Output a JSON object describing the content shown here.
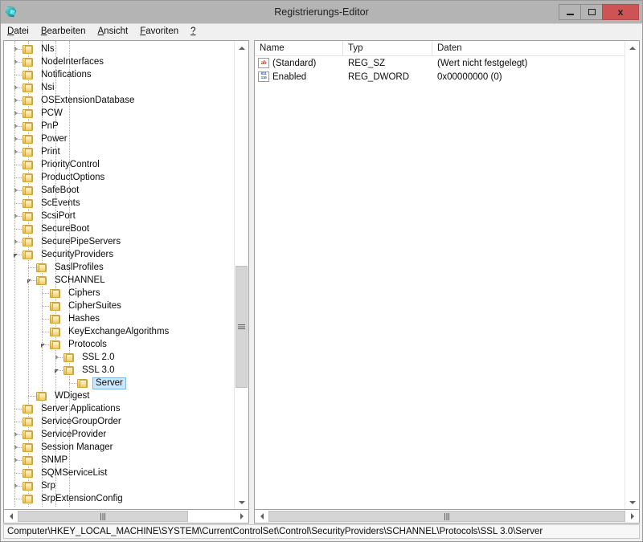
{
  "window": {
    "title": "Registrierungs-Editor",
    "app_icon": "registry-editor-icon",
    "controls": {
      "minimize": "minimize-button",
      "maximize": "maximize-button",
      "close_label": "x"
    }
  },
  "menubar": {
    "items": [
      {
        "acc": "D",
        "rest": "atei"
      },
      {
        "acc": "B",
        "rest": "earbeiten"
      },
      {
        "acc": "A",
        "rest": "nsicht"
      },
      {
        "acc": "F",
        "rest": "avoriten"
      },
      {
        "acc": "?",
        "rest": ""
      }
    ]
  },
  "tree": {
    "rows": [
      {
        "label": "Nls",
        "depth": 1,
        "state": "collapsed"
      },
      {
        "label": "NodeInterfaces",
        "depth": 1,
        "state": "collapsed"
      },
      {
        "label": "Notifications",
        "depth": 1,
        "state": "leaf"
      },
      {
        "label": "Nsi",
        "depth": 1,
        "state": "collapsed"
      },
      {
        "label": "OSExtensionDatabase",
        "depth": 1,
        "state": "collapsed"
      },
      {
        "label": "PCW",
        "depth": 1,
        "state": "collapsed"
      },
      {
        "label": "PnP",
        "depth": 1,
        "state": "collapsed"
      },
      {
        "label": "Power",
        "depth": 1,
        "state": "collapsed"
      },
      {
        "label": "Print",
        "depth": 1,
        "state": "collapsed"
      },
      {
        "label": "PriorityControl",
        "depth": 1,
        "state": "leaf"
      },
      {
        "label": "ProductOptions",
        "depth": 1,
        "state": "leaf"
      },
      {
        "label": "SafeBoot",
        "depth": 1,
        "state": "collapsed"
      },
      {
        "label": "ScEvents",
        "depth": 1,
        "state": "leaf"
      },
      {
        "label": "ScsiPort",
        "depth": 1,
        "state": "collapsed"
      },
      {
        "label": "SecureBoot",
        "depth": 1,
        "state": "leaf"
      },
      {
        "label": "SecurePipeServers",
        "depth": 1,
        "state": "collapsed"
      },
      {
        "label": "SecurityProviders",
        "depth": 1,
        "state": "expanded"
      },
      {
        "label": "SaslProfiles",
        "depth": 2,
        "state": "leaf"
      },
      {
        "label": "SCHANNEL",
        "depth": 2,
        "state": "expanded"
      },
      {
        "label": "Ciphers",
        "depth": 3,
        "state": "leaf"
      },
      {
        "label": "CipherSuites",
        "depth": 3,
        "state": "leaf"
      },
      {
        "label": "Hashes",
        "depth": 3,
        "state": "leaf"
      },
      {
        "label": "KeyExchangeAlgorithms",
        "depth": 3,
        "state": "leaf"
      },
      {
        "label": "Protocols",
        "depth": 3,
        "state": "expanded"
      },
      {
        "label": "SSL 2.0",
        "depth": 4,
        "state": "collapsed"
      },
      {
        "label": "SSL 3.0",
        "depth": 4,
        "state": "expanded"
      },
      {
        "label": "Server",
        "depth": 5,
        "state": "leaf",
        "selected": true
      },
      {
        "label": "WDigest",
        "depth": 2,
        "state": "leaf"
      },
      {
        "label": "Server Applications",
        "depth": 1,
        "state": "leaf"
      },
      {
        "label": "ServiceGroupOrder",
        "depth": 1,
        "state": "leaf"
      },
      {
        "label": "ServiceProvider",
        "depth": 1,
        "state": "collapsed"
      },
      {
        "label": "Session Manager",
        "depth": 1,
        "state": "collapsed"
      },
      {
        "label": "SNMP",
        "depth": 1,
        "state": "collapsed"
      },
      {
        "label": "SQMServiceList",
        "depth": 1,
        "state": "leaf"
      },
      {
        "label": "Srp",
        "depth": 1,
        "state": "collapsed"
      },
      {
        "label": "SrpExtensionConfig",
        "depth": 1,
        "state": "leaf"
      }
    ]
  },
  "values": {
    "columns": [
      "Name",
      "Typ",
      "Daten"
    ],
    "rows": [
      {
        "icon": "string-value-icon",
        "icon_glyph": "ab",
        "name": "(Standard)",
        "type": "REG_SZ",
        "data": "(Wert nicht festgelegt)"
      },
      {
        "icon": "dword-value-icon",
        "icon_glyph": "011\n110",
        "name": "Enabled",
        "type": "REG_DWORD",
        "data": "0x00000000 (0)"
      }
    ]
  },
  "statusbar": {
    "path": "Computer\\HKEY_LOCAL_MACHINE\\SYSTEM\\CurrentControlSet\\Control\\SecurityProviders\\SCHANNEL\\Protocols\\SSL 3.0\\Server"
  },
  "colors": {
    "titlebar": "#b4b4b4",
    "close_button": "#cc5454",
    "selection_fill": "#cce8ff",
    "selection_border": "#7cb7e6",
    "folder": "#f3cf6a",
    "scroll_thumb": "#d5d5d5"
  }
}
